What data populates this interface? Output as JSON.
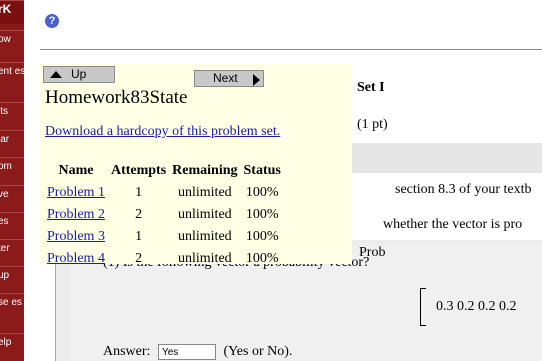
{
  "sidebar": {
    "color": "#8b1a1a",
    "items": [
      {
        "label": "rK"
      },
      {
        "label": "ow"
      },
      {
        "label": "ent es"
      },
      {
        "label": "its"
      },
      {
        "label": "lar"
      },
      {
        "label": "om"
      },
      {
        "label": "ve"
      },
      {
        "label": "es"
      },
      {
        "label": "ter"
      },
      {
        "label": "up"
      },
      {
        "label": "se es"
      },
      {
        "label": "elp"
      }
    ]
  },
  "help_icon": "?",
  "nav": {
    "up_label": "Up",
    "next_label": "Next",
    "set_title": "Homework83State",
    "download_link": "Download a hardcopy of this problem set.",
    "columns": [
      "Name",
      "Attempts",
      "Remaining",
      "Status"
    ],
    "rows": [
      {
        "name": "Problem 1",
        "attempts": "1",
        "remaining": "unlimited",
        "status": "100%"
      },
      {
        "name": "Problem 2",
        "attempts": "2",
        "remaining": "unlimited",
        "status": "100%"
      },
      {
        "name": "Problem 3",
        "attempts": "1",
        "remaining": "unlimited",
        "status": "100%"
      },
      {
        "name": "Problem 4",
        "attempts": "2",
        "remaining": "unlimited",
        "status": "100%"
      }
    ]
  },
  "problem": {
    "set_info_heading": "Set I",
    "points": "(1 pt)",
    "line1": "section 8.3 of your textb",
    "line2": "whether the vector is pro",
    "prob_label": "Prob",
    "question": "(1) Is the following vector a probability vector?",
    "vector_values": "0.3  0.2  0.2  0.2",
    "answer_label": "Answer:",
    "answer_value": "Yes",
    "answer_hint": "(Yes or No)."
  }
}
